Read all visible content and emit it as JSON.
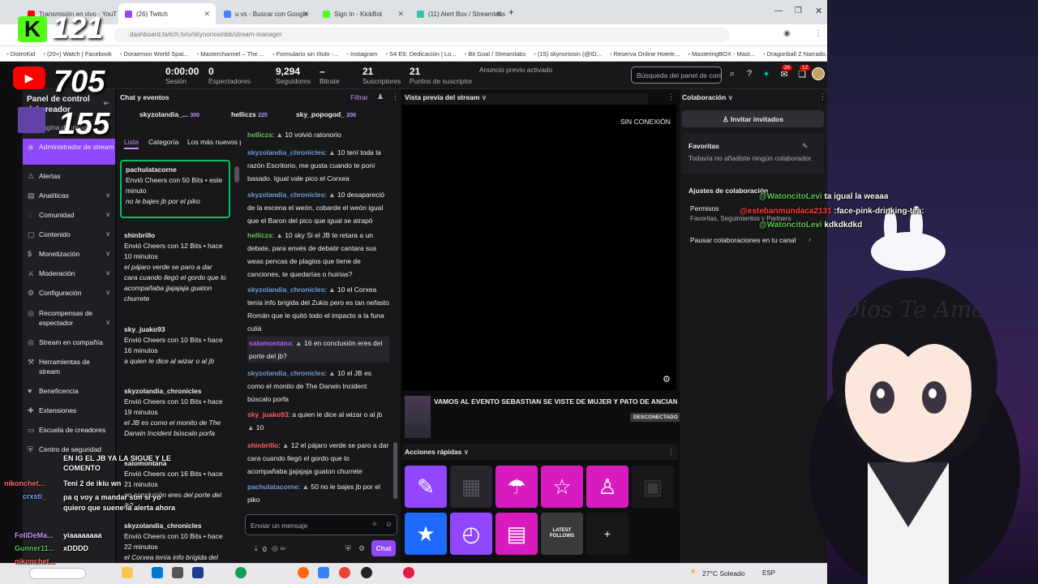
{
  "browser": {
    "tabs": [
      {
        "label": "Transmisión en vivo - YouTube",
        "color": "#ff0000"
      },
      {
        "label": "(26) Twitch",
        "color": "#9147ff"
      },
      {
        "label": "u vs - Buscar con Google",
        "color": "#4285f4"
      },
      {
        "label": "Sign In - KickBot",
        "color": "#53fc18"
      },
      {
        "label": "(11) Alert Box / Streamlabs",
        "color": "#31c3a2"
      }
    ],
    "address": "dashboard.twitch.tv/u/skynoriosinbb/stream-manager",
    "bookmarks": [
      "DistroKid",
      "(20+) Watch | Facebook",
      "Doraemon World Spai...",
      "Masterchannel – The ...",
      "Formulario sin título -...",
      "Instagram",
      "S4 E6: Dedicación | Lo...",
      "Bit Goal / Streamlabs",
      "(15) skynoriosin (@ID...",
      "Reserva Online Hotele...",
      "MasteringBOX - Mast...",
      "Dragonball Z Narrado..."
    ]
  },
  "stats": [
    {
      "value": "0:00:00",
      "label": "Sesión"
    },
    {
      "value": "0",
      "label": "Espectadores"
    },
    {
      "value": "9,294",
      "label": "Seguidores"
    },
    {
      "value": "–",
      "label": "Bitrate"
    },
    {
      "value": "21",
      "label": "Suscriptores"
    },
    {
      "value": "21",
      "label": "Puntos de suscriptor"
    },
    {
      "value": "",
      "label": "Anuncio previo activado"
    }
  ],
  "search_placeholder": "Búsqueda del panel de contro",
  "badges": {
    "notifications": "26",
    "whispers": "12"
  },
  "sidebar": {
    "title": "Panel de control del creador",
    "home": "Página de inicio",
    "items": [
      {
        "label": "Administrador de stream",
        "icon": "stream-manager-icon",
        "active": true
      },
      {
        "label": "Alertas",
        "icon": "alerts-icon"
      },
      {
        "label": "Analíticas",
        "icon": "analytics-icon",
        "chevron": true
      },
      {
        "label": "Comunidad",
        "icon": "community-icon",
        "chevron": true
      },
      {
        "label": "Contenido",
        "icon": "content-icon",
        "chevron": true
      },
      {
        "label": "Monetización",
        "icon": "monetization-icon",
        "chevron": true
      },
      {
        "label": "Moderación",
        "icon": "moderation-icon",
        "chevron": true
      },
      {
        "label": "Configuración",
        "icon": "settings-icon",
        "chevron": true
      },
      {
        "label": "Recompensas de espectador",
        "icon": "rewards-icon",
        "chevron": true
      },
      {
        "label": "Stream en compañía",
        "icon": "together-icon"
      },
      {
        "label": "Herramientas de stream",
        "icon": "tools-icon"
      },
      {
        "label": "Beneficencia",
        "icon": "charity-icon"
      },
      {
        "label": "Extensiones",
        "icon": "extensions-icon"
      },
      {
        "label": "Escuela de creadores",
        "icon": "school-icon"
      },
      {
        "label": "Centro de seguridad",
        "icon": "safety-icon"
      }
    ]
  },
  "chat_panel": {
    "title": "Chat y eventos",
    "filter": "Filtrar",
    "top_gifters": [
      {
        "name": "skyzolandia_...",
        "amount": "300"
      },
      {
        "name": "helliczs",
        "amount": "225"
      },
      {
        "name": "sky_popogod_",
        "amount": "200"
      }
    ],
    "tabs": [
      "Lista",
      "Categoría",
      "Los más nuevos pr"
    ],
    "activity": [
      {
        "name": "pachulatacorne",
        "text": "Envió Cheers con 50 Bits • este minuto",
        "msg": "no le bajes jb por el piko"
      },
      {
        "name": "shinbrillo",
        "text": "Envió Cheers con 12 Bits • hace 10 minutos",
        "msg": "el pájaro verde se paro a dar cara cuando llegó el gordo que lo acompañaba jjajajaja guaton churrete"
      },
      {
        "name": "sky_juako93",
        "text": "Envió Cheers con 10 Bits • hace 16 minutos",
        "msg": "a quien le dice al wizar o al jb"
      },
      {
        "name": "skyzolandia_chronicles",
        "text": "Envió Cheers con 10 Bits • hace 19 minutos",
        "msg": "el JB es como el monito de The Darwin Incident búscalo porfa"
      },
      {
        "name": "salomontana",
        "text": "Envió Cheers con 16 Bits • hace 21 minutos",
        "msg": "en conclusión eres del porte del jb?"
      },
      {
        "name": "skyzolandia_chronicles",
        "text": "Envió Cheers con 10 Bits • hace 22 minutos",
        "msg": "el Corxea tenía info brígida del"
      }
    ],
    "messages": [
      {
        "user": "helliczs",
        "cls": "u-green",
        "bits": "10",
        "text": "volvió ratonorio"
      },
      {
        "user": "skyzolandia_chronicles",
        "cls": "u-blue",
        "bits": "10",
        "text": "tení toda la razón Escritorio, me gusta cuando te poní basado. Igual vale pico el Corxea"
      },
      {
        "user": "skyzolandia_chronicles",
        "cls": "u-blue",
        "bits": "10",
        "text": "desapareció de la escena el weón, cobarde el weón igual que el Baron del pico que igual se atrapó"
      },
      {
        "user": "helliczs",
        "cls": "u-green",
        "bits": "10",
        "text": "sky Si el JB te retara a un debate, para envés de debatir cantara sus weas pencas de plagios que tiene de canciones, te quedarías o huirias?"
      },
      {
        "user": "skyzolandia_chronicles",
        "cls": "u-blue",
        "bits": "10",
        "text": "el Corxea tenía info brígida del Zukis pero es tan nefasto Román que le quitó todo el impacto a la funa culiá"
      },
      {
        "user": "salomontana",
        "cls": "u-purple",
        "bits": "16",
        "text": "en conclusión eres del porte del jb?"
      },
      {
        "user": "skyzolandia_chronicles",
        "cls": "u-blue",
        "bits": "10",
        "text": "el JB es como el monito de The Darwin Incident búscalo porfa"
      },
      {
        "user": "sky_juako93",
        "cls": "u-red",
        "bits": "10",
        "text": "a quien le dice al wizar o al jb"
      },
      {
        "user": "shinbrillo",
        "cls": "u-red",
        "bits": "12",
        "text": "el pájaro verde se paro a dar cara cuando llegó el gordo que lo acompañaba jjajajaja guaton churrete"
      },
      {
        "user": "pachulatacorne",
        "cls": "u-blue",
        "bits": "50",
        "text": "no le bajes jb por el piko"
      }
    ],
    "input_placeholder": "Enviar un mensaje",
    "points": "0",
    "chat_button": "Chat"
  },
  "preview": {
    "title": "Vista previa del stream",
    "offline": "SIN CONEXIÓN",
    "stream_title": "VAMOS AL EVENTO SEBASTIAN SE VISTE DE MUJER Y PATO DE ANCIANO DIOS T A",
    "status": "DESCONECTADO",
    "quick_actions_title": "Acciones rápidas",
    "latest_follows": "LATEST FOLLOWS"
  },
  "collab": {
    "title": "Colaboración",
    "invite": "Invitar invitados",
    "favorites_title": "Favoritas",
    "favorites_text": "Todavía no añadiste ningún colaborador.",
    "settings_title": "Ajustes de colaboración",
    "permissions_title": "Permisos",
    "permissions_text": "Favoritas, Seguimientos y Partners",
    "pause": "Pausar colaboraciones en tu canal"
  },
  "overlay": {
    "kick_count": "121",
    "youtube_count": "705",
    "twitch_count": "155",
    "chat_lines": [
      {
        "user": "@WatoncitoLevi",
        "text": "ta igual la weaaa",
        "color": "#5ec451"
      },
      {
        "user": "@estebanmundaca2131",
        "text": ":face-pink-drinking-tea:",
        "color": "#ff4040"
      },
      {
        "user": "@WatoncitoLevi",
        "text": "kdkdkdkd",
        "color": "#5ec451"
      }
    ],
    "banner_text": "Dios Te Ama",
    "left_chat": [
      {
        "user": "",
        "text": "EN IG EL JB YA LA SIGUE Y LE COMENTO"
      },
      {
        "user": "nikonchet...",
        "text": "Teni 2 de ikiu wn"
      },
      {
        "user": "crxsti_",
        "text": "pa q voy a mandar stm si yo quiero que suene la alerta ahora"
      },
      {
        "user": "FoliDeMa...",
        "text": "yiaaaaaaaa"
      },
      {
        "user": "Gunner11...",
        "text": "xDDDD"
      },
      {
        "user": "nikonchet...",
        "text": ""
      }
    ]
  },
  "taskbar": {
    "weather": "27°C Soleado",
    "lang": "ESP"
  }
}
